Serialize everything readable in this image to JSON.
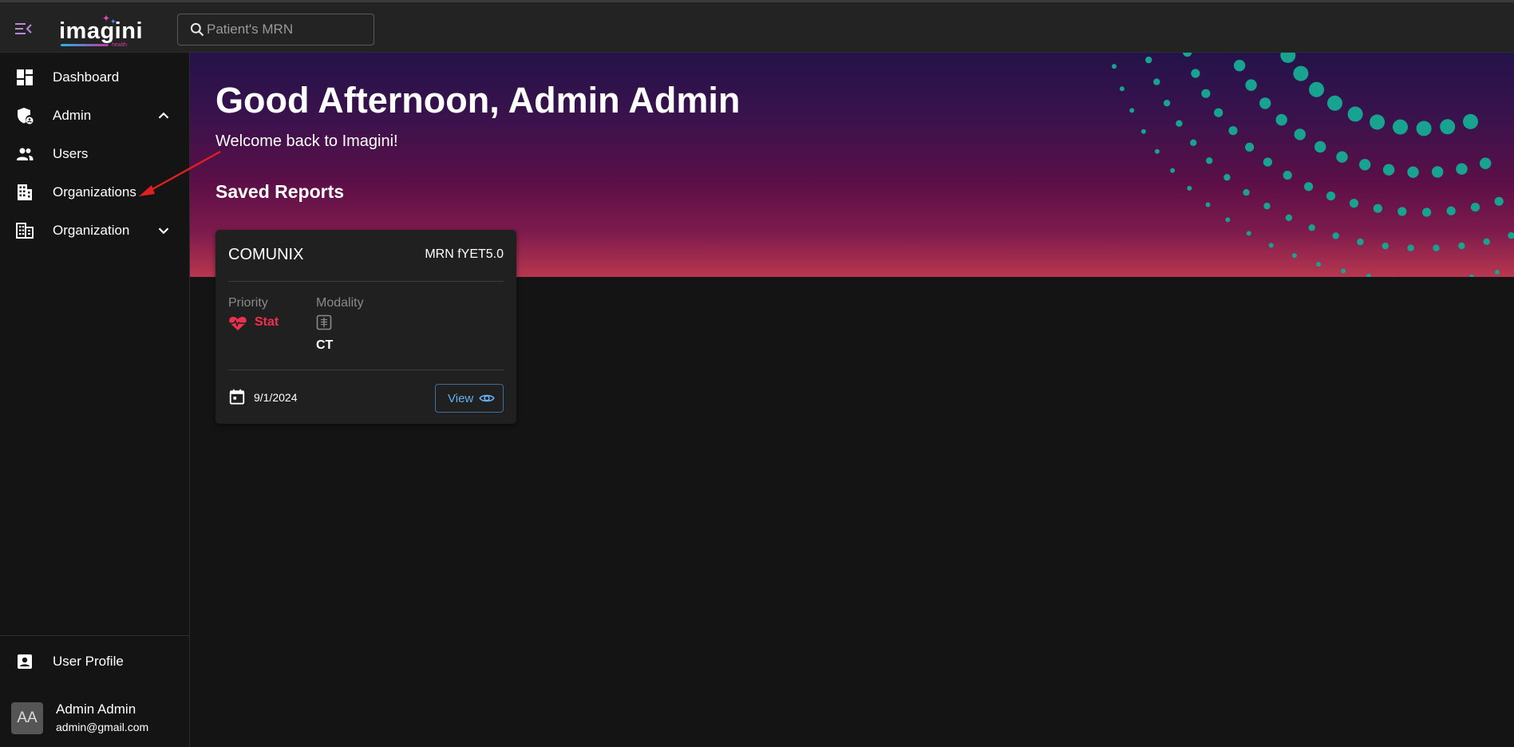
{
  "topbar": {
    "logo_text": "imagini",
    "logo_subtext": "health",
    "search_placeholder": "Patient's MRN"
  },
  "sidebar": {
    "items": [
      {
        "label": "Dashboard",
        "icon": "dashboard-icon"
      },
      {
        "label": "Admin",
        "icon": "admin-shield-icon",
        "expanded": true
      },
      {
        "label": "Users",
        "icon": "users-icon"
      },
      {
        "label": "Organizations",
        "icon": "organizations-icon"
      },
      {
        "label": "Organization",
        "icon": "organization-icon",
        "expanded": false
      }
    ],
    "profile_label": "User Profile",
    "user": {
      "initials": "AA",
      "name": "Admin Admin",
      "email": "admin@gmail.com"
    }
  },
  "main": {
    "greeting": "Good Afternoon, Admin Admin",
    "welcome": "Welcome back to Imagini!",
    "saved_reports_title": "Saved Reports",
    "reports": [
      {
        "title": "COMUNIX",
        "mrn": "MRN fYET5.0",
        "priority_label": "Priority",
        "priority_value": "Stat",
        "modality_label": "Modality",
        "modality_value": "CT",
        "date": "9/1/2024",
        "view_label": "View"
      }
    ]
  },
  "colors": {
    "accent_red": "#f0304f",
    "link_blue": "#63b0f2",
    "dot_teal": "#17a38f",
    "annotation_arrow": "#e02020"
  }
}
